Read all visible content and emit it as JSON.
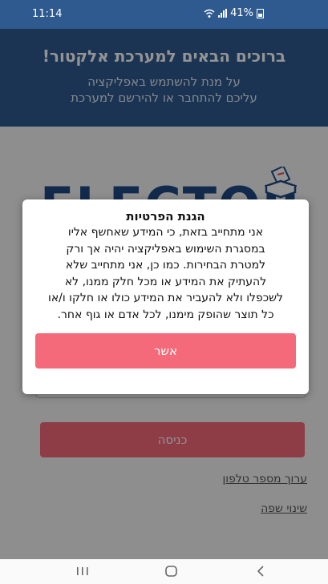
{
  "status_bar": {
    "time": "11:14",
    "battery_percent": "41%"
  },
  "header": {
    "title": "ברוכים הבאים למערכת אלקטור!",
    "subtitle_line1": "על מנת להשתמש באפליקציה",
    "subtitle_line2": "עליכם להתחבר או להירשם למערכת"
  },
  "logo": {
    "text": "ELECTOR"
  },
  "login": {
    "enter_label": "כניסה",
    "edit_phone_label": "ערוך מספר טלפון",
    "change_language_label": "שינוי שפה"
  },
  "dialog": {
    "title": "הגנת הפרטיות",
    "body_lines": [
      "אני מתחייב בזאת, כי המידע שאחשף אליו",
      "במסגרת השימוש באפליקציה יהיה אך ורק",
      "למטרת הבחירות. כמו כן, אני מתחייב שלא",
      "להעתיק את המידע או מכל חלק ממנו, לא",
      "לשכפלו ולא להעביר את המידע כולו או חלקו ו/או",
      "כל תוצר שהופק מימנו, לכל אדם או גוף אחר."
    ],
    "confirm_label": "אשר"
  },
  "colors": {
    "header_blue": "#2f5a8f",
    "button_pink": "#f46a7a",
    "logo_blue": "#1f4a86"
  },
  "nav": {
    "recent_icon": "recent-apps-icon",
    "home_icon": "home-icon",
    "back_icon": "back-icon"
  }
}
